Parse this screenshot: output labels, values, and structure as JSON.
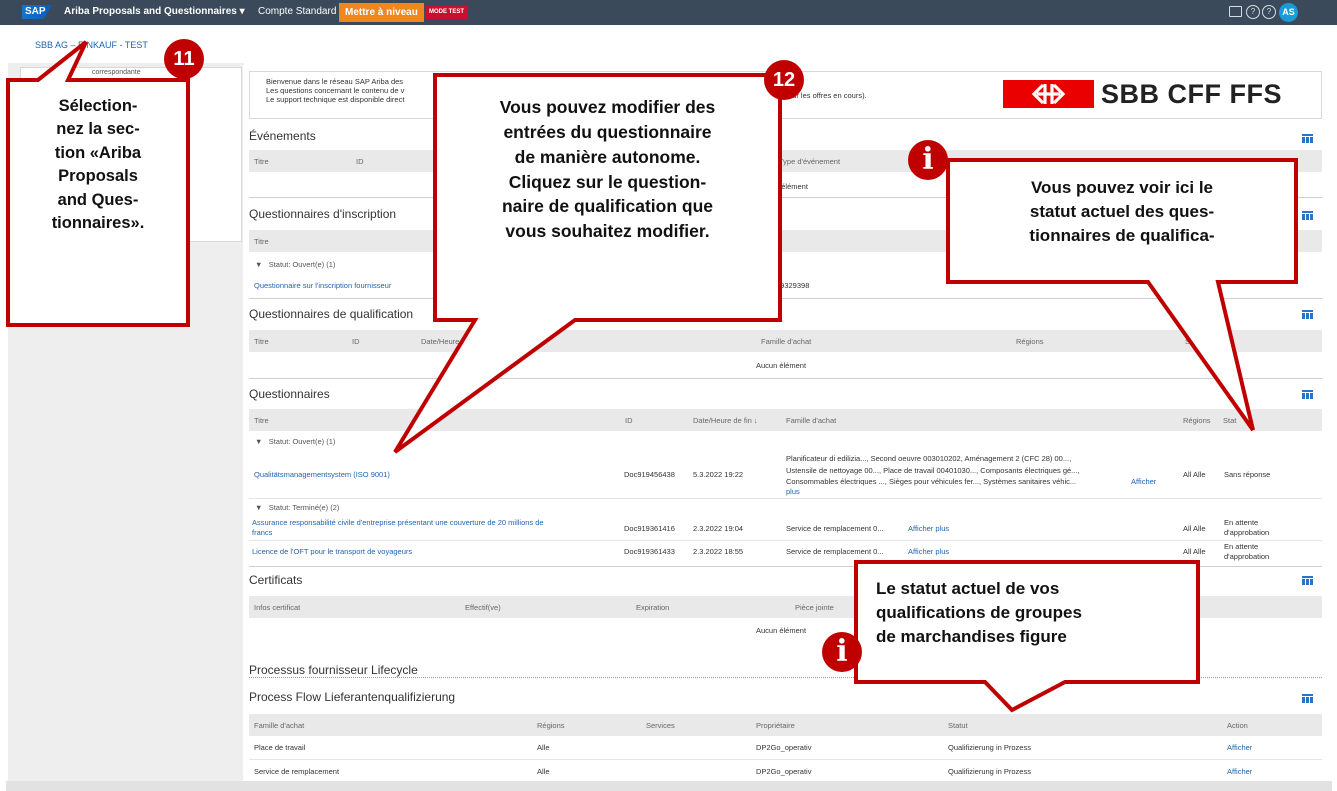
{
  "topbar": {
    "sap_logo": "SAP",
    "app_title": "Ariba Proposals and Questionnaires",
    "account": "Compte Standard",
    "upgrade_button": "Mettre à niveau",
    "test_badge": "MODE TEST",
    "help_icon_glyph": "?",
    "avatar_initials": "AS"
  },
  "breadcrumb": "SBB AG – EINKAUF - TEST",
  "left_card_label": "correspondante",
  "welcome": {
    "line1": "Bienvenue dans le réseau SAP Ariba des",
    "line2": "Les questions concernant le contenu de v",
    "line3": "Le support technique est disponible direct",
    "tail": "on sur les offres en cours)."
  },
  "logo_text": "SBB CFF FFS",
  "sections": {
    "events": {
      "title": "Événements",
      "columns": [
        "Titre",
        "ID",
        "Type d'événement"
      ],
      "empty": "n élément"
    },
    "registration": {
      "title": "Questionnaires d'inscription",
      "columns": [
        "Titre"
      ],
      "group": "Statut: Ouvert(e)  (1)",
      "row_title": "Questionnaire sur l'inscription fournisseur",
      "row_id": "19329398"
    },
    "qualification": {
      "title": "Questionnaires de qualification",
      "columns": [
        "Titre",
        "ID",
        "Date/Heure d",
        "Famille d'achat",
        "Régions",
        "Statu"
      ],
      "empty": "Aucun élément"
    },
    "questionnaires": {
      "title": "Questionnaires",
      "columns": [
        "Titre",
        "ID",
        "Date/Heure de fin  ↓",
        "Famille d'achat",
        "Régions",
        "Stat"
      ],
      "group_open": "Statut: Ouvert(e)  (1)",
      "group_done": "Statut: Terminé(e)  (2)",
      "rows": [
        {
          "title": "Qualitätsmanagementsystem (ISO 9001)",
          "id": "Doc919456438",
          "date": "5.3.2022 19:22",
          "family_lines": [
            "Planificateur di edilizia..., Second oeuvre 003010202, Aménagement 2 (CFC 28) 00...,",
            "Ustensile de nettoyage 00..., Place de travail 00401030..., Composants électriques gé...,",
            "Consommables électriques ..., Sièges pour véhicules fer..., Systèmes sanitaires véhic..."
          ],
          "more": "Afficher",
          "more2": "plus",
          "regions": "All Alle",
          "status": "Sans réponse"
        },
        {
          "title_line1": "Assurance responsabilité civile d'entreprise présentant une couverture de 20 millions de",
          "title_line2": "francs",
          "id": "Doc919361416",
          "date": "2.3.2022 19:04",
          "family": "Service de remplacement 0...",
          "more": "Afficher plus",
          "regions": "All Alle",
          "status_line1": "En attente",
          "status_line2": "d'approbation"
        },
        {
          "title": "Licence de l'OFT pour le transport de voyageurs",
          "id": "Doc919361433",
          "date": "2.3.2022 18:55",
          "family": "Service de remplacement 0...",
          "more": "Afficher plus",
          "regions": "All Alle",
          "status_line1": "En attente",
          "status_line2": "d'approbation"
        }
      ]
    },
    "certificates": {
      "title": "Certificats",
      "columns": [
        "Infos certificat",
        "Effectif(ve)",
        "Expiration",
        "Pièce jointe"
      ],
      "empty": "Aucun élément"
    },
    "lifecycle_title": "Processus fournisseur Lifecycle",
    "process_flow": {
      "title": "Process Flow Lieferantenqualifizierung",
      "columns": [
        "Famille d'achat",
        "Régions",
        "Services",
        "Propriétaire",
        "Statut",
        "Action"
      ],
      "rows": [
        {
          "family": "Place de travail",
          "regions": "Alle",
          "owner": "DP2Go_operativ",
          "status": "Qualifizierung in Prozess",
          "action": "Afficher"
        },
        {
          "family": "Service de remplacement",
          "regions": "Alle",
          "owner": "DP2Go_operativ",
          "status": "Qualifizierung in Prozess",
          "action": "Afficher"
        }
      ]
    }
  },
  "callouts": {
    "c11": {
      "badge": "11",
      "lines": [
        "Sélection-",
        "nez la sec-",
        "tion «Ariba",
        "Proposals",
        "and Ques-",
        "tionnaires»."
      ]
    },
    "c12": {
      "badge": "12",
      "lines": [
        "Vous pouvez modifier des",
        "entrées du questionnaire",
        "de manière autonome.",
        "Cliquez sur le question-",
        "naire de qualification que",
        "vous souhaitez modifier."
      ]
    },
    "info1": {
      "badge": "i",
      "lines": [
        "Vous pouvez voir ici le",
        "statut actuel des ques-",
        "tionnaires de qualifica-"
      ]
    },
    "info2": {
      "badge": "i",
      "lines": [
        "Le statut actuel de vos",
        "qualifications de groupes",
        "de marchandises figure"
      ]
    }
  },
  "colors": {
    "topbar": "#3b4a5a",
    "upgrade": "#f0871e",
    "callout_red": "#c00000",
    "link": "#2064b0",
    "sbb_red": "#eb0000"
  }
}
